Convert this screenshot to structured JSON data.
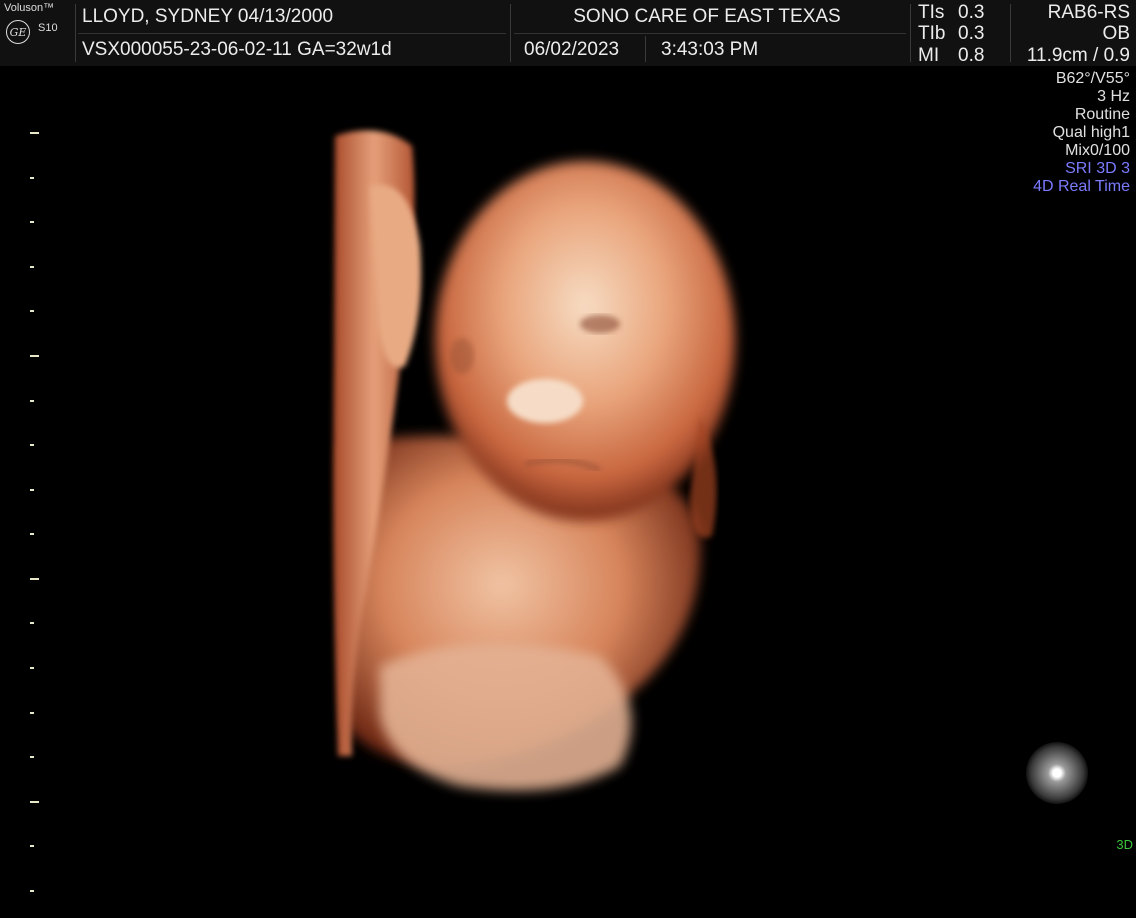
{
  "device": {
    "brand": "Voluson™",
    "logo": "GE",
    "model": "S10"
  },
  "header": {
    "patient": "LLOYD, SYDNEY  04/13/2000",
    "exam": "VSX000055-23-06-02-11  GA=32w1d",
    "clinic": "SONO CARE OF EAST TEXAS",
    "date": "06/02/2023",
    "time": "3:43:03 PM"
  },
  "indices": {
    "tis": {
      "label": "TIs",
      "value": "0.3"
    },
    "tib": {
      "label": "TIb",
      "value": "0.3"
    },
    "mi": {
      "label": "MI",
      "value": "0.8"
    }
  },
  "probe": {
    "name": "RAB6-RS",
    "preset": "OB",
    "depth": "11.9cm / 0.9"
  },
  "params": {
    "angles": "B62°/V55°",
    "rate": "3 Hz",
    "mode": "Routine",
    "quality": "Qual high1",
    "mix": "Mix0/100",
    "sri": "SRI 3D 3",
    "realtime": "4D Real Time"
  },
  "colors": {
    "accent_blue": "#7b7bff",
    "mode_green": "#3cc43c",
    "skin_tone": "#d98a5e"
  },
  "icons": {
    "logo": "ge-monogram-icon",
    "orientation": "light-sphere-icon"
  },
  "footer": {
    "mode_label": "3D"
  }
}
